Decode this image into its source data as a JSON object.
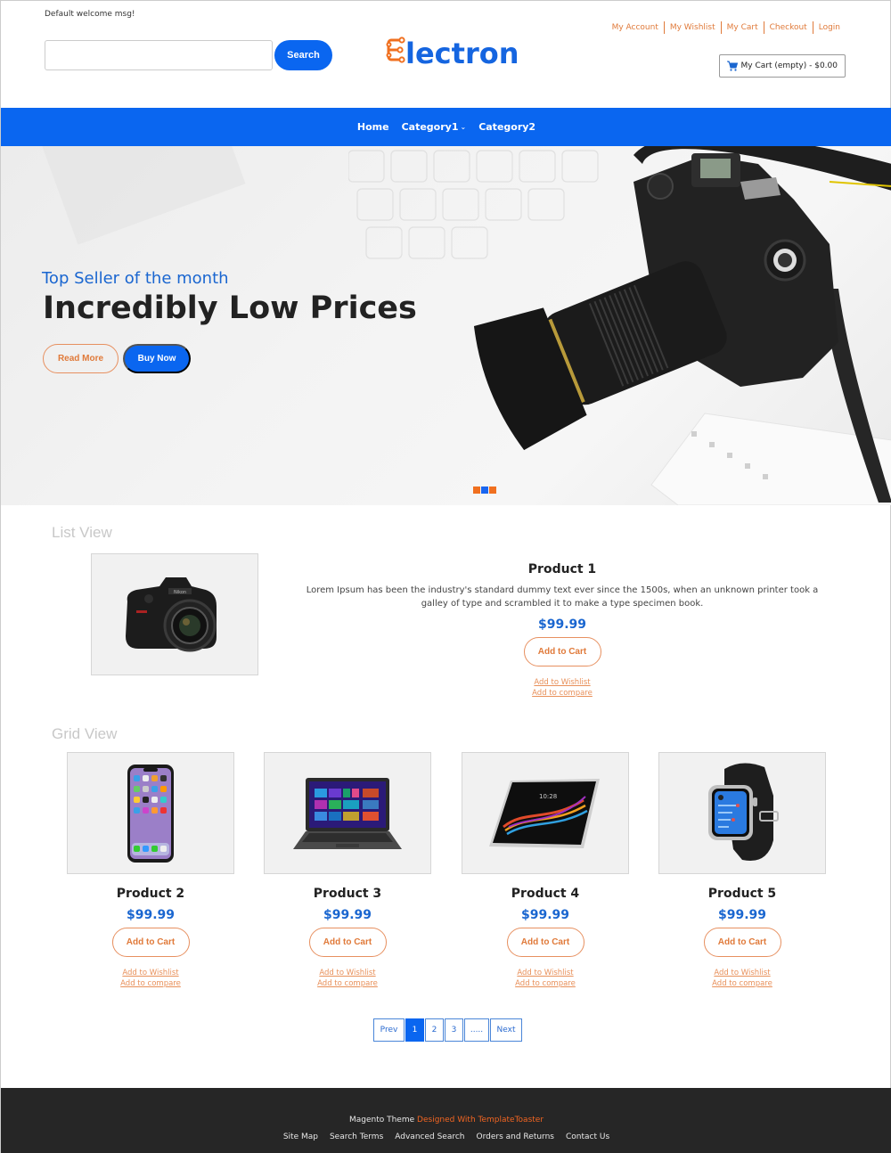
{
  "header": {
    "welcome": "Default welcome msg!",
    "search": {
      "value": "",
      "placeholder": "",
      "button_label": "Search"
    },
    "logo": {
      "first_letter": "E",
      "rest": "lectron"
    },
    "top_links": [
      "My Account",
      "My Wishlist",
      "My Cart",
      "Checkout",
      "Login"
    ],
    "cart": {
      "label": "My Cart (empty) - $0.00"
    }
  },
  "nav": {
    "items": [
      {
        "label": "Home",
        "has_dropdown": false
      },
      {
        "label": "Category1",
        "has_dropdown": true
      },
      {
        "label": "Category2",
        "has_dropdown": false
      }
    ]
  },
  "hero": {
    "subtitle": "Top Seller of the month",
    "title": "Incredibly Low Prices",
    "read_more_label": "Read More",
    "buy_now_label": "Buy Now",
    "slides_count": 3,
    "active_slide": 2
  },
  "list_view": {
    "title": "List View",
    "product": {
      "name": "Product 1",
      "image": "dslr-camera",
      "description": "Lorem Ipsum has been the industry's standard dummy text ever since the 1500s, when an unknown printer took a galley of type and scrambled it to make a type specimen book.",
      "price": "$99.99",
      "add_to_cart": "Add to Cart",
      "add_to_wishlist": "Add to Wishlist",
      "add_to_compare": "Add to compare"
    }
  },
  "grid_view": {
    "title": "Grid View",
    "products": [
      {
        "name": "Product 2",
        "image": "smartphone",
        "price": "$99.99",
        "add_to_cart": "Add to Cart",
        "add_to_wishlist": "Add to Wishlist",
        "add_to_compare": "Add to compare"
      },
      {
        "name": "Product 3",
        "image": "laptop",
        "price": "$99.99",
        "add_to_cart": "Add to Cart",
        "add_to_wishlist": "Add to Wishlist",
        "add_to_compare": "Add to compare"
      },
      {
        "name": "Product 4",
        "image": "tablet",
        "price": "$99.99",
        "add_to_cart": "Add to Cart",
        "add_to_wishlist": "Add to Wishlist",
        "add_to_compare": "Add to compare"
      },
      {
        "name": "Product 5",
        "image": "smartwatch",
        "price": "$99.99",
        "add_to_cart": "Add to Cart",
        "add_to_wishlist": "Add to Wishlist",
        "add_to_compare": "Add to compare"
      }
    ]
  },
  "pagination": {
    "prev": "Prev",
    "pages": [
      "1",
      "2",
      "3",
      "....."
    ],
    "next": "Next",
    "current": "1"
  },
  "footer": {
    "credit_prefix": "Magento Theme",
    "credit_link": "Designed With TemplateToaster",
    "links": [
      "Site Map",
      "Search Terms",
      "Advanced Search",
      "Orders and Returns",
      "Contact Us"
    ]
  },
  "colors": {
    "primary_blue": "#0a66f0",
    "accent_orange": "#e07a3a",
    "price_blue": "#1a66d0",
    "footer_bg": "#262626",
    "footer_accent": "#f26522"
  }
}
